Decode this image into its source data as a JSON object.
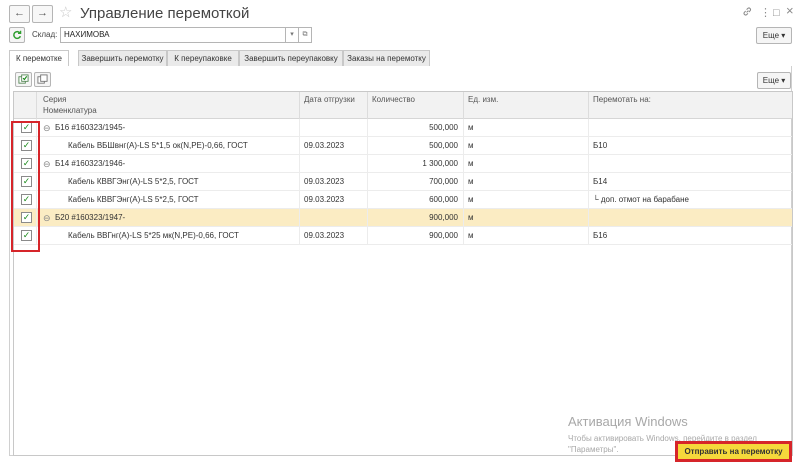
{
  "window": {
    "title": "Управление перемоткой",
    "nav_back": "←",
    "nav_forward": "→",
    "star": "☆",
    "link_icon": "🔗",
    "menu_icon": "⋮",
    "restore_icon": "□",
    "close_icon": "×"
  },
  "toolbar": {
    "refresh_icon": "C",
    "sklad_label": "Склад:",
    "sklad_value": "НАХИМОВА",
    "dropdown_icon": "▾",
    "open_icon": "⧉",
    "more_label": "Еще ▾"
  },
  "tabs": [
    {
      "label": "К перемотке"
    },
    {
      "label": "Завершить перемотку"
    },
    {
      "label": "К переупаковке"
    },
    {
      "label": "Завершить переупаковку"
    },
    {
      "label": "Заказы на перемотку"
    }
  ],
  "panel": {
    "more_label": "Еще ▾"
  },
  "table": {
    "headers": {
      "series": "Серия",
      "nomenclature": "Номенклатура",
      "date": "Дата отгрузки",
      "qty": "Количество",
      "unit": "Ед. изм.",
      "rewind_to": "Перемотать на:"
    },
    "rows": [
      {
        "checked": "✓",
        "group": true,
        "expander": "⊖",
        "name": "Б16 #160323/1945-",
        "date": "",
        "qty": "500,000",
        "unit": "м",
        "rewind": ""
      },
      {
        "checked": "✓",
        "group": false,
        "expander": "",
        "name": "Кабель ВБШвнг(А)-LS 5*1,5 ок(N,PE)-0,66, ГОСТ",
        "date": "09.03.2023",
        "qty": "500,000",
        "unit": "м",
        "rewind": "Б10"
      },
      {
        "checked": "✓",
        "group": true,
        "expander": "⊖",
        "name": "Б14 #160323/1946-",
        "date": "",
        "qty": "1 300,000",
        "unit": "м",
        "rewind": ""
      },
      {
        "checked": "✓",
        "group": false,
        "expander": "",
        "name": "Кабель КВВГЭнг(А)-LS 5*2,5, ГОСТ",
        "date": "09.03.2023",
        "qty": "700,000",
        "unit": "м",
        "rewind": "Б14"
      },
      {
        "checked": "✓",
        "group": false,
        "expander": "",
        "name": "Кабель КВВГЭнг(А)-LS 5*2,5, ГОСТ",
        "date": "09.03.2023",
        "qty": "600,000",
        "unit": "м",
        "rewind": "└ доп. отмот на барабане"
      },
      {
        "checked": "✓",
        "group": true,
        "expander": "⊖",
        "name": "Б20 #160323/1947-",
        "date": "",
        "qty": "900,000",
        "unit": "м",
        "rewind": "",
        "selected": true
      },
      {
        "checked": "✓",
        "group": false,
        "expander": "",
        "name": "Кабель ВВГнг(А)-LS 5*25 мк(N,PE)-0,66, ГОСТ",
        "date": "09.03.2023",
        "qty": "900,000",
        "unit": "м",
        "rewind": "Б16"
      }
    ]
  },
  "activation": {
    "title": "Активация Windows",
    "line1": "Чтобы активировать Windows, перейдите в раздел",
    "line2": "\"Параметры\"."
  },
  "footer": {
    "send_button": "Отправить на перемотку"
  },
  "colors": {
    "accent_red": "#d6252a",
    "button_yellow": "#f5d93b",
    "selected_row": "#fbecc3",
    "check_green": "#1b8a1b"
  }
}
